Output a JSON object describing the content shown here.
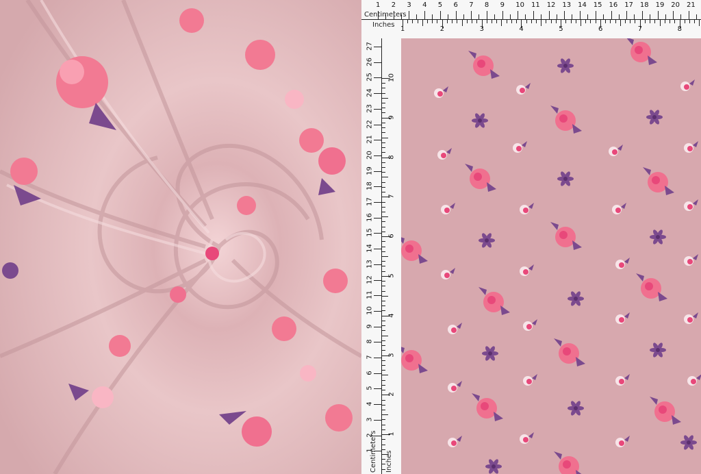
{
  "ruler": {
    "centimeters_label": "Centimeters",
    "inches_label": "Inches",
    "top_cm_numbers": [
      "1",
      "2",
      "3",
      "4",
      "5",
      "6",
      "7",
      "8",
      "9",
      "10",
      "11",
      "12",
      "13",
      "14",
      "15",
      "16",
      "17",
      "18",
      "19",
      "20",
      "21"
    ],
    "top_in_numbers": [
      "1",
      "2",
      "3",
      "4",
      "5",
      "6",
      "7",
      "8"
    ],
    "side_cm_numbers": [
      "27",
      "26",
      "25",
      "24",
      "23",
      "22",
      "21",
      "20",
      "19",
      "18",
      "17",
      "16",
      "15",
      "14",
      "13",
      "12",
      "11",
      "10",
      "9",
      "8",
      "7",
      "6",
      "5",
      "4",
      "3",
      "2",
      "1"
    ],
    "side_in_numbers": [
      "10",
      "9",
      "8",
      "7",
      "6",
      "5",
      "4",
      "3",
      "2",
      "1"
    ]
  },
  "colors": {
    "fabric": "#d7a8ae",
    "flower_pink": "#f0708f",
    "flower_hot": "#e8487a",
    "leaf_purple": "#7b4a8e",
    "ruler_bg": "#f7f7f7"
  }
}
